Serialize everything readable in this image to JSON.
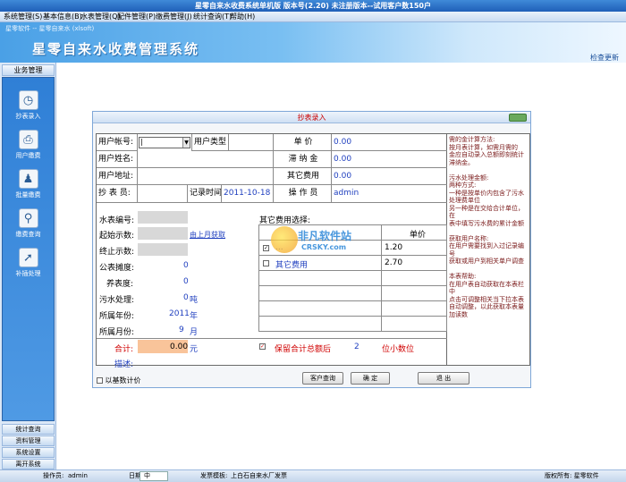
{
  "titlebar": {
    "title": "星零自来水收费系统单机版 版本号(2.20) 未注册版本--试用客户数150户"
  },
  "menu": [
    "系统管理(S)",
    "基本信息(B)",
    "水表管理(Q)",
    "配件管理(P)",
    "缴费管理(J)",
    "统计查询(T)",
    "帮助(H)"
  ],
  "banner": {
    "small": "星零软件 -- 星零自来水 (xlsoft)",
    "title": "星零自来水收费管理系统",
    "refresh": "检查更新"
  },
  "sidebar": {
    "header": "业务管理",
    "items": [
      "抄表录入",
      "用户缴费",
      "批量缴费",
      "缴费查询",
      "补插处理"
    ],
    "bottom": [
      "统计查询",
      "资料管理",
      "系统设置",
      "离开系统"
    ]
  },
  "window": {
    "title": "抄表录入",
    "row1": {
      "account_label": "用户帐号:",
      "account_value": "|",
      "type_label": "用户类型",
      "price_label": "单  价",
      "price_value": "0.00"
    },
    "row2": {
      "name_label": "用户姓名:",
      "late_label": "滞 纳 金",
      "late_value": "0.00"
    },
    "row3": {
      "addr_label": "用户地址:",
      "other_label": "其它费用",
      "other_value": "0.00"
    },
    "row4": {
      "reader_label": "抄 表 员:",
      "time_label": "记录时间",
      "time_value": "2011-10-18",
      "operator_label": "操 作 员",
      "operator_value": "admin"
    },
    "meter": {
      "meter_no": "水表编号:",
      "last_link": "由上月获取",
      "start": "起始示数:",
      "end": "终止示数:",
      "public": "公表摊度:",
      "public_v": "0",
      "nurture": "养表度:",
      "nurture_v": "0",
      "sewage": "污水处理:",
      "sewage_v": "0",
      "sewage_unit": "吨",
      "year": "所属年份:",
      "year_v": "2011",
      "year_unit": "年",
      "month": "所属月份:",
      "month_v": "9",
      "month_unit": "月",
      "total": "合计:",
      "total_v": "0.00",
      "total_unit": "元",
      "desc": "描述:"
    },
    "other_fee": {
      "title": "其它费用选择:",
      "col_price": "单价",
      "rows": [
        {
          "checked": "✓",
          "name": "...",
          "price": "1.20"
        },
        {
          "checked": "",
          "name": "其它费用",
          "price": "2.70"
        }
      ]
    },
    "keep": {
      "mark": "✓",
      "label": "保留合计总额后",
      "digits": "2",
      "suffix": "位小数位"
    },
    "right_help": "需的金计算方法:\n按月表计算，如需月需的\n金应自动录入总额即刻统计\n滞纳金。\n\n污水处理金额:\n两种方式:\n一种是按单价内包含了污水\n处理费单位\n另一种是在交给合计单位，在\n表中填写污水费的累计金额\n\n获取用户名称:\n在用户需要找到入过记录编号\n获取或用户到相关单户调查\n\n本表帮助:\n在用户表自动获取在本表栏中\n点击可调整相关当下拉本表\n自动调整，以此获取本表量\n加读数",
    "base_check": "以基数计价",
    "btn_query": "客户查询",
    "btn_ok": "确  定",
    "btn_exit": "退  出"
  },
  "watermark": {
    "text": "非凡软件站",
    "sub": "CRSKY.com"
  },
  "status": {
    "operator_label": "操作员:",
    "operator": "admin",
    "date_label": "日期",
    "ime": "中",
    "fapiao_label": "发票模板:",
    "fapiao": "上白石自来水厂发票",
    "owner": "版权所有: 星零软件"
  }
}
